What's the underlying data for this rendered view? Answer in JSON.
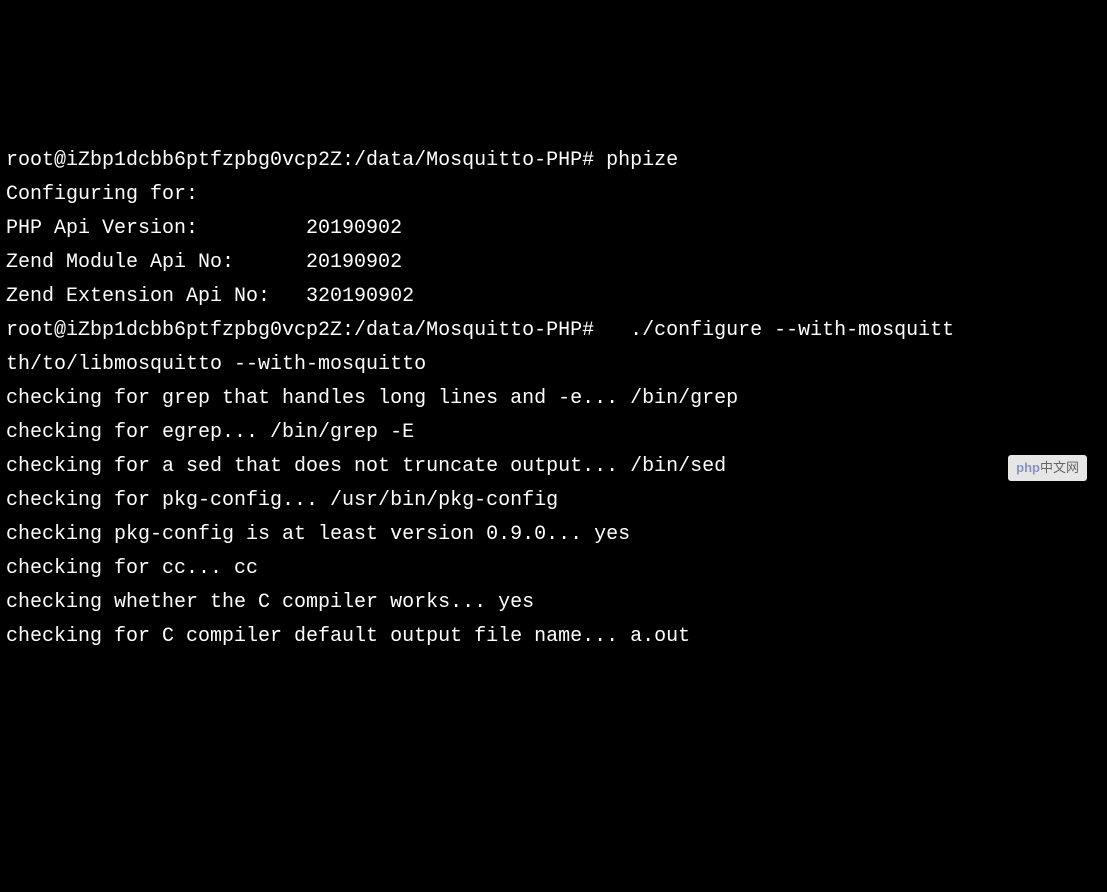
{
  "terminal": {
    "lines": [
      "root@iZbp1dcbb6ptfzpbg0vcp2Z:/data/Mosquitto-PHP# phpize",
      "Configuring for:",
      "PHP Api Version:         20190902",
      "Zend Module Api No:      20190902",
      "Zend Extension Api No:   320190902",
      "root@iZbp1dcbb6ptfzpbg0vcp2Z:/data/Mosquitto-PHP#   ./configure --with-mosquitt",
      "th/to/libmosquitto --with-mosquitto",
      "checking for grep that handles long lines and -e... /bin/grep",
      "checking for egrep... /bin/grep -E",
      "checking for a sed that does not truncate output... /bin/sed",
      "checking for pkg-config... /usr/bin/pkg-config",
      "checking pkg-config is at least version 0.9.0... yes",
      "checking for cc... cc",
      "checking whether the C compiler works... yes",
      "checking for C compiler default output file name... a.out"
    ]
  },
  "watermark": {
    "brand": "php",
    "suffix": "中文网"
  }
}
